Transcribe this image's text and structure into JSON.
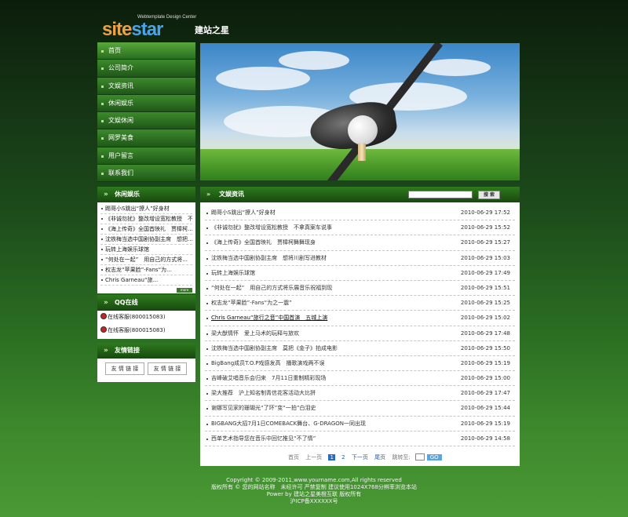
{
  "logo": {
    "brand_a": "site",
    "brand_b": "star",
    "tagline": "Webtemplate Design Center",
    "cn": "建站之星"
  },
  "nav": [
    {
      "label": "首页"
    },
    {
      "label": "公司简介"
    },
    {
      "label": "文娱资讯"
    },
    {
      "label": "休闲娱乐"
    },
    {
      "label": "文娱休闲"
    },
    {
      "label": "网罗美食"
    },
    {
      "label": "用户留言"
    },
    {
      "label": "联系我们"
    }
  ],
  "leisure": {
    "title": "休闲娱乐",
    "more": "more",
    "items": [
      "踢哥小S跳出“撩人”好身材",
      "《非诚勿扰》整改增设宽松教授　不...",
      "《海上传奇》全国首映礼　贾樟柯...",
      "沈铁梅当选中国剧协副主席　想把...",
      "玩转上海娱乐球馆",
      "“何处在一起”　用自己的方式将...",
      "权志龙“苹果脸”-Fans“为...",
      "Chris Garneau“旅..."
    ]
  },
  "qq": {
    "title": "QQ在线",
    "rows": [
      "在线客服(800015083)",
      "在线客服(800015083)"
    ]
  },
  "friends": {
    "title": "友情链接",
    "links": [
      "友 情 链 接",
      "友 情 链 接"
    ]
  },
  "main": {
    "title": "文娱资讯",
    "search_btn": "搜 索",
    "items": [
      {
        "t": "踢哥小S跳出“撩人”好身材",
        "d": "2010-06-29 17:52"
      },
      {
        "t": "《非诚勿扰》整改增设宽松教授　不拿真案车说事",
        "d": "2010-06-29 15:52"
      },
      {
        "t": "《海上传奇》全国首映礼　贾樟柯舞舞现身",
        "d": "2010-06-29 15:27"
      },
      {
        "t": "沈铁梅当选中国剧协副主席　想将川剧写进教材",
        "d": "2010-06-29 15:03"
      },
      {
        "t": "玩转上海娱乐球馆",
        "d": "2010-06-29 17:49"
      },
      {
        "t": "“何处在一起”　用自己的方式将乐展音乐祝福到现",
        "d": "2010-06-29 15:51"
      },
      {
        "t": "权志龙“苹果脸”-Fans“为之一震”",
        "d": "2010-06-29 15:25"
      },
      {
        "t": "Chris Garneau“旅行之音”中国首演　五城上演",
        "d": "2010-06-29 15:02"
      },
      {
        "t": "梁大猷情怀　爱上马术的玩释与旅欢",
        "d": "2010-06-29 17:48"
      },
      {
        "t": "沈铁梅当选中国剧协副主席　莫把《金子》拍成电影",
        "d": "2010-06-29 15:50"
      },
      {
        "t": "BigBang成员T.O.P戏感发高　播歌演戏两不误",
        "d": "2010-06-29 15:19"
      },
      {
        "t": "吉峰破艾唱音乐会归来　7月11日重制精彩现场",
        "d": "2010-06-29 15:00"
      },
      {
        "t": "梁大推荐　沪上知名制青信花客活动大比拼",
        "d": "2010-06-29 17:47"
      },
      {
        "t": "谢娜写见家的珊瑚光“了环”变“一拍”白泪史",
        "d": "2010-06-29 15:44"
      },
      {
        "t": "BIGBANG大招7月1日COMEBACK舞台、G-DRAGON一同出现",
        "d": "2010-06-29 15:19"
      },
      {
        "t": "西单艺术指导您在音乐中回忆推见“不了情”",
        "d": "2010-06-29 14:58"
      }
    ]
  },
  "pager": {
    "first": "首页",
    "prev": "上一页",
    "p1": "1",
    "p2": "2",
    "next": "下一页",
    "last": "尾页",
    "jump": "跳转至:",
    "go": "GO"
  },
  "footer": {
    "l1": "Copyright © 2009-2011,www.yourname.com,All rights reserved",
    "l2": "版权所有 © 您的网站名称　未经许可 严禁复制 建议使用1024X768分辨率浏览本站",
    "l3": "Power by 建站之星美橙互联 版权所有",
    "l4": "沪ICP备XXXXXX号"
  }
}
